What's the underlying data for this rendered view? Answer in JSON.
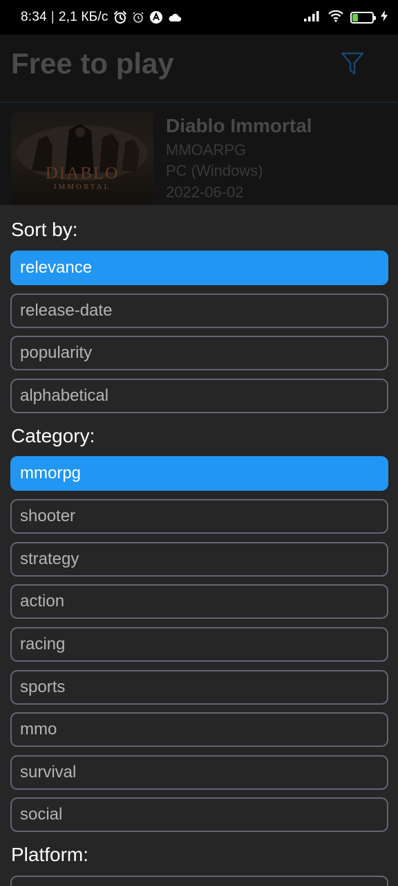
{
  "status_bar": {
    "time": "8:34",
    "separator": "|",
    "speed": "2,1 КБ/с",
    "battery_level": "25",
    "icons": [
      "alarm-icon",
      "alarm-outline-icon",
      "app-a-icon",
      "cloud-icon",
      "signal-icon",
      "wifi-icon",
      "battery-icon",
      "charging-bolt-icon"
    ]
  },
  "app_bar": {
    "title": "Free to play",
    "filter_icon": "filter-funnel-icon",
    "accent_color": "#1a4470"
  },
  "game": {
    "title": "Diablo Immortal",
    "genre": "MMOARPG",
    "platform": "PC (Windows)",
    "release_date": "2022-06-02",
    "thumb_logo": "DIABLO",
    "thumb_logo_sub": "IMMORTAL"
  },
  "filters": {
    "sort_title": "Sort by:",
    "sort_options": [
      {
        "label": "relevance",
        "selected": true
      },
      {
        "label": "release-date",
        "selected": false
      },
      {
        "label": "popularity",
        "selected": false
      },
      {
        "label": "alphabetical",
        "selected": false
      }
    ],
    "category_title": "Category:",
    "category_options": [
      {
        "label": "mmorpg",
        "selected": true
      },
      {
        "label": "shooter",
        "selected": false
      },
      {
        "label": "strategy",
        "selected": false
      },
      {
        "label": "action",
        "selected": false
      },
      {
        "label": "racing",
        "selected": false
      },
      {
        "label": "sports",
        "selected": false
      },
      {
        "label": "mmo",
        "selected": false
      },
      {
        "label": "survival",
        "selected": false
      },
      {
        "label": "social",
        "selected": false
      }
    ],
    "platform_title": "Platform:"
  },
  "colors": {
    "selected_bg": "#2196f3",
    "option_border": "#63637a",
    "sheet_bg": "#262626"
  }
}
